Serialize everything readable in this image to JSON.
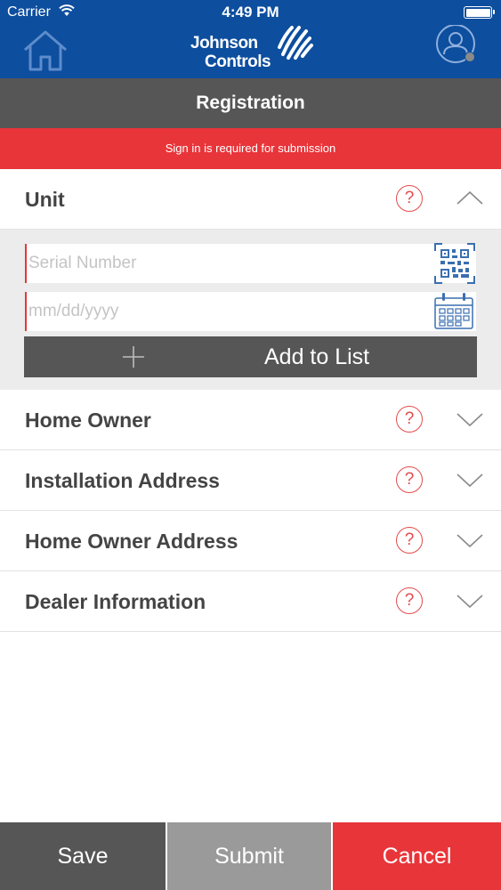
{
  "status_bar": {
    "carrier": "Carrier",
    "time": "4:49 PM"
  },
  "header": {
    "brand_line1": "Johnson",
    "brand_line2": "Controls",
    "icons": {
      "home": "home-icon",
      "profile": "user-profile-icon"
    }
  },
  "page": {
    "title": "Registration",
    "alert": "Sign in is required for submission"
  },
  "sections": {
    "unit": {
      "label": "Unit",
      "help": "?",
      "expanded": true,
      "serial_placeholder": "Serial Number",
      "date_placeholder": "mm/dd/yyyy",
      "add_label": "Add to List"
    },
    "home_owner": {
      "label": "Home Owner",
      "help": "?"
    },
    "installation_address": {
      "label": "Installation Address",
      "help": "?"
    },
    "home_owner_address": {
      "label": "Home Owner Address",
      "help": "?"
    },
    "dealer_information": {
      "label": "Dealer Information",
      "help": "?"
    }
  },
  "footer": {
    "save": "Save",
    "submit": "Submit",
    "cancel": "Cancel"
  },
  "colors": {
    "brand_blue": "#0d4e9e",
    "dark_gray": "#565656",
    "alert_red": "#e8353a",
    "disabled_gray": "#9a9a9a",
    "icon_blue": "#3a6fb0"
  }
}
